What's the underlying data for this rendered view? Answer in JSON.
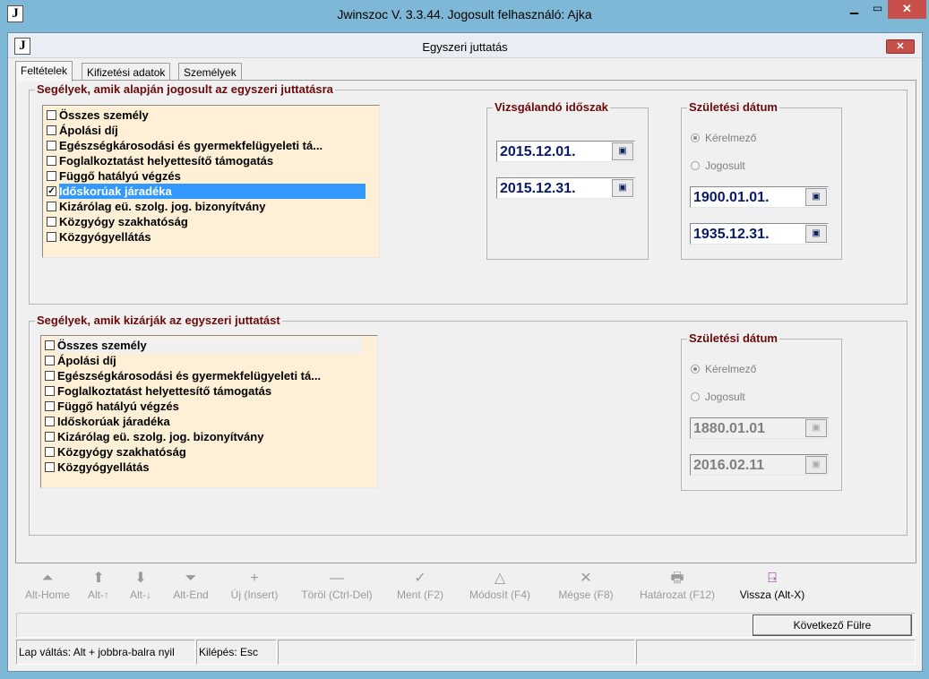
{
  "app": {
    "window_title": "Jwinszoc V. 3.3.44.  Jogosult felhasználó: Ajka",
    "icon_letter": "J",
    "close_glyph": "✕"
  },
  "dialog": {
    "title": "Egyszeri juttatás",
    "icon_letter": "J",
    "close_glyph": "✕"
  },
  "tabs": [
    {
      "label": "Feltételek",
      "active": true
    },
    {
      "label": "Kifizetési adatok",
      "active": false
    },
    {
      "label": "Személyek",
      "active": false
    }
  ],
  "eligible_group": {
    "legend": "Segélyek, amik alapján jogosult az egyszeri juttatásra",
    "items": [
      {
        "label": "Összes személy",
        "checked": false
      },
      {
        "label": "Ápolási díj",
        "checked": false
      },
      {
        "label": "Egészségkárosodási és gyermekfelügyeleti tá...",
        "checked": false
      },
      {
        "label": "Foglalkoztatást helyettesítő támogatás",
        "checked": false
      },
      {
        "label": "Függő hatályú végzés",
        "checked": false
      },
      {
        "label": "Időskorúak járadéka",
        "checked": true,
        "selected": true
      },
      {
        "label": "Kizárólag eü. szolg. jog. bizonyítvány",
        "checked": false
      },
      {
        "label": "Közgyógy szakhatóság",
        "checked": false
      },
      {
        "label": "Közgyógyellátás",
        "checked": false
      }
    ]
  },
  "period": {
    "legend": "Vizsgálandó időszak",
    "from": "2015.12.01.",
    "to": "2015.12.31."
  },
  "birth_top": {
    "legend": "Születési dátum",
    "radio_applicant": "Kérelmező",
    "radio_eligible": "Jogosult",
    "selected_radio": "Kérelmező",
    "from": "1900.01.01.",
    "to": "1935.12.31."
  },
  "excluded_group": {
    "legend": "Segélyek, amik kizárják az egyszeri juttatást",
    "items": [
      {
        "label": "Összes személy",
        "checked": false,
        "focused": true
      },
      {
        "label": "Ápolási díj",
        "checked": false
      },
      {
        "label": "Egészségkárosodási és gyermekfelügyeleti tá...",
        "checked": false
      },
      {
        "label": "Foglalkoztatást helyettesítő támogatás",
        "checked": false
      },
      {
        "label": "Függő hatályú végzés",
        "checked": false
      },
      {
        "label": "Időskorúak járadéka",
        "checked": false
      },
      {
        "label": "Kizárólag eü. szolg. jog. bizonyítvány",
        "checked": false
      },
      {
        "label": "Közgyógy szakhatóság",
        "checked": false
      },
      {
        "label": "Közgyógyellátás",
        "checked": false
      }
    ]
  },
  "birth_bottom": {
    "legend": "Születési dátum",
    "radio_applicant": "Kérelmező",
    "radio_eligible": "Jogosult",
    "selected_radio": "Kérelmező",
    "from": "1880.01.01",
    "to": "2016.02.11"
  },
  "toolbar": {
    "first": {
      "label": "Alt-Home",
      "icon": "first-record-icon",
      "glyph": "⏶",
      "enabled": false
    },
    "prev": {
      "label": "Alt-↑",
      "icon": "arrow-up-icon",
      "glyph": "⬆",
      "enabled": false
    },
    "next": {
      "label": "Alt-↓",
      "icon": "arrow-down-icon",
      "glyph": "⬇",
      "enabled": false
    },
    "last": {
      "label": "Alt-End",
      "icon": "last-record-icon",
      "glyph": "⏷",
      "enabled": false
    },
    "new": {
      "label": "Új (Insert)",
      "icon": "plus-icon",
      "glyph": "+",
      "enabled": false
    },
    "delete": {
      "label": "Töröl (Ctrl-Del)",
      "icon": "minus-icon",
      "glyph": "—",
      "enabled": false
    },
    "save": {
      "label": "Ment (F2)",
      "icon": "checkmark-icon",
      "glyph": "✓",
      "enabled": false
    },
    "edit": {
      "label": "Módosít (F4)",
      "icon": "edit-triangle-icon",
      "glyph": "△",
      "enabled": false
    },
    "cancel": {
      "label": "Mégse (F8)",
      "icon": "cross-icon",
      "glyph": "✕",
      "enabled": false
    },
    "decision": {
      "label": "Határozat (F12)",
      "icon": "printer-icon",
      "glyph": "🖶",
      "enabled": false
    },
    "back": {
      "label": "Vissza (Alt-X)",
      "icon": "exit-door-icon",
      "glyph": "⍈",
      "enabled": true
    }
  },
  "next_tab_button": "Következő Fülre",
  "status": {
    "hint": "Lap váltás: Alt + jobbra-balra nyil",
    "exit": "Kilépés: Esc",
    "cell3": "",
    "cell4": ""
  },
  "colors": {
    "list_bg": "#fdf0d6",
    "legend_text": "#6b0a0a",
    "date_text": "#0a1a6a",
    "selection": "#3399ff",
    "outer_frame": "#7fb7d6"
  }
}
